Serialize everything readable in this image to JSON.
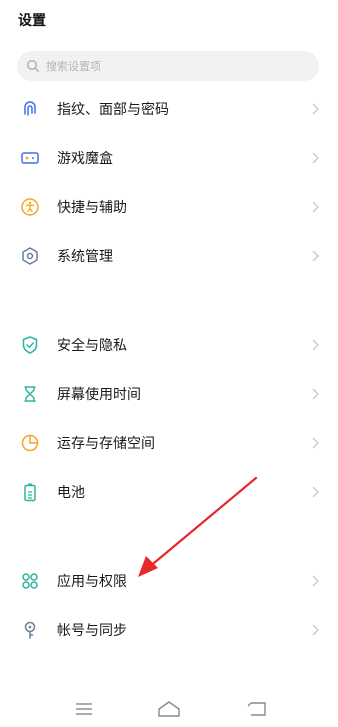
{
  "header": {
    "title": "设置"
  },
  "search": {
    "placeholder": "搜索设置项"
  },
  "items": [
    {
      "id": "fingerprint",
      "label": "指纹、面部与密码",
      "icon": "fingerprint-icon"
    },
    {
      "id": "game",
      "label": "游戏魔盒",
      "icon": "game-box-icon"
    },
    {
      "id": "shortcut",
      "label": "快捷与辅助",
      "icon": "accessibility-icon"
    },
    {
      "id": "system",
      "label": "系统管理",
      "icon": "hexagon-settings-icon"
    },
    {
      "id": "security",
      "label": "安全与隐私",
      "icon": "shield-icon"
    },
    {
      "id": "screentime",
      "label": "屏幕使用时间",
      "icon": "hourglass-icon"
    },
    {
      "id": "storage",
      "label": "运存与存储空间",
      "icon": "pie-chart-icon"
    },
    {
      "id": "battery",
      "label": "电池",
      "icon": "battery-icon"
    },
    {
      "id": "apps",
      "label": "应用与权限",
      "icon": "apps-grid-icon"
    },
    {
      "id": "account",
      "label": "帐号与同步",
      "icon": "key-icon"
    }
  ],
  "colors": {
    "accent_teal": "#2cb59b",
    "accent_orange": "#f5a623",
    "accent_blue": "#3d6ff0",
    "arrow_red": "#e8282b"
  },
  "navbar": {
    "icons": [
      "menu-icon",
      "home-icon",
      "back-icon"
    ]
  }
}
